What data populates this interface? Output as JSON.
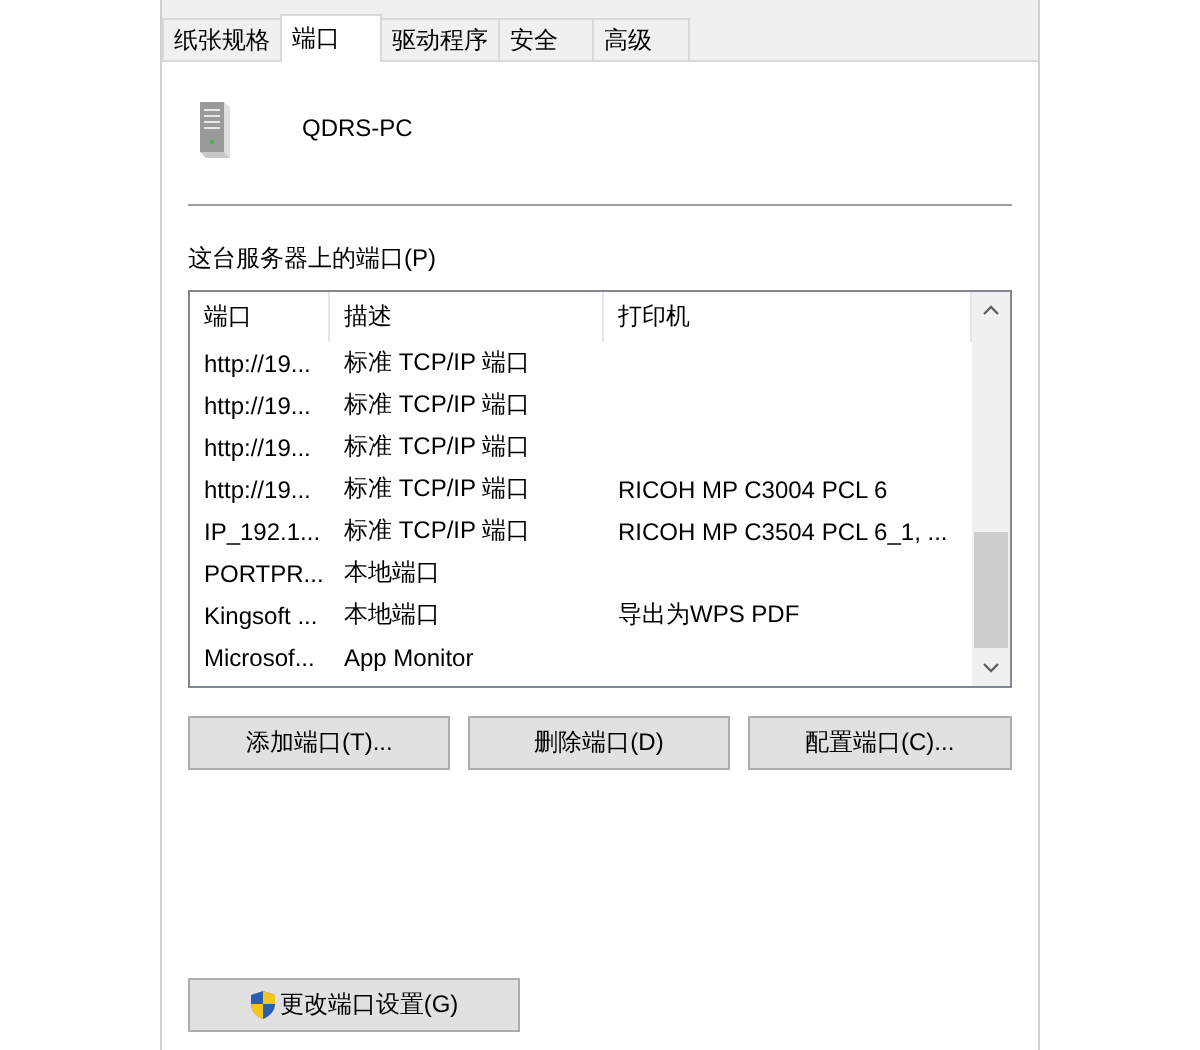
{
  "tabs": [
    {
      "label": "纸张规格",
      "selected": false
    },
    {
      "label": "端口",
      "selected": true
    },
    {
      "label": "驱动程序",
      "selected": false
    },
    {
      "label": "安全",
      "selected": false
    },
    {
      "label": "高级",
      "selected": false
    }
  ],
  "server": {
    "name": "QDRS-PC"
  },
  "ports_label": "这台服务器上的端口(P)",
  "ports_table": {
    "columns": [
      "端口",
      "描述",
      "打印机"
    ],
    "rows": [
      {
        "port": "http://19...",
        "description": "标准 TCP/IP 端口",
        "printer": ""
      },
      {
        "port": "http://19...",
        "description": "标准 TCP/IP 端口",
        "printer": ""
      },
      {
        "port": "http://19...",
        "description": "标准 TCP/IP 端口",
        "printer": ""
      },
      {
        "port": "http://19...",
        "description": "标准 TCP/IP 端口",
        "printer": "RICOH MP C3004 PCL 6"
      },
      {
        "port": "IP_192.1...",
        "description": "标准 TCP/IP 端口",
        "printer": "RICOH MP C3504 PCL 6_1, ..."
      },
      {
        "port": "PORTPR...",
        "description": "本地端口",
        "printer": ""
      },
      {
        "port": "Kingsoft ...",
        "description": "本地端口",
        "printer": "导出为WPS PDF"
      },
      {
        "port": "Microsof...",
        "description": "App Monitor",
        "printer": ""
      }
    ]
  },
  "port_buttons": [
    "添加端口(T)...",
    "删除端口(D)",
    "配置端口(C)..."
  ],
  "change_settings_button": "更改端口设置(G)"
}
